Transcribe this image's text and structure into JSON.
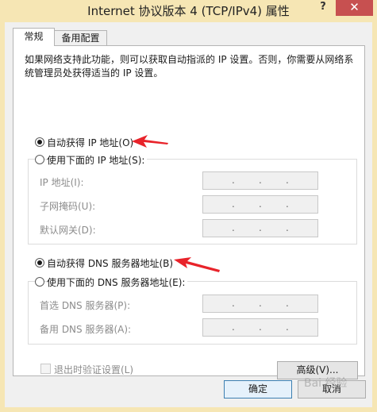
{
  "window": {
    "title": "Internet 协议版本 4 (TCP/IPv4) 属性",
    "help_glyph": "?",
    "close_glyph": "✕"
  },
  "tabs": [
    {
      "label": "常规"
    },
    {
      "label": "备用配置"
    }
  ],
  "description": "如果网络支持此功能，则可以获取自动指派的 IP 设置。否则，你需要从网络系统管理员处获得适当的 IP 设置。",
  "ip": {
    "auto_label": "自动获得 IP 地址(O)",
    "manual_label": "使用下面的 IP 地址(S):",
    "fields": [
      {
        "label": "IP 地址(I):"
      },
      {
        "label": "子网掩码(U):"
      },
      {
        "label": "默认网关(D):"
      }
    ]
  },
  "dns": {
    "auto_label": "自动获得 DNS 服务器地址(B)",
    "manual_label": "使用下面的 DNS 服务器地址(E):",
    "fields": [
      {
        "label": "首选 DNS 服务器(P):"
      },
      {
        "label": "备用 DNS 服务器(A):"
      }
    ]
  },
  "ip_dot": ".",
  "validate_label": "退出时验证设置(L)",
  "advanced_label": "高级(V)...",
  "ok_label": "确定",
  "cancel_label": "取消",
  "watermark": "Bai 经验",
  "colors": {
    "title_bar": "#f6e6b4",
    "close_button": "#c75050",
    "annotation_arrow": "#e8232a"
  }
}
